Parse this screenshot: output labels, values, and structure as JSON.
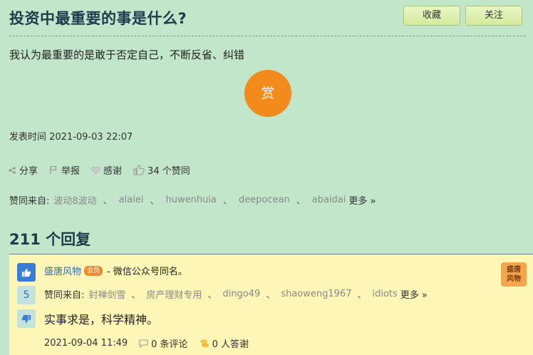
{
  "post": {
    "title": "投资中最重要的事是什么?",
    "body": "我认为最重要的是敢于否定自己，不断反省、纠错",
    "time_label": "发表时间 2021-09-03 22:07",
    "reward_label": "赏"
  },
  "buttons": {
    "favorite": "收藏",
    "follow": "关注"
  },
  "actions": {
    "share": "分享",
    "report": "举报",
    "thanks": "感谢",
    "likes": "34 个赞同"
  },
  "likers": {
    "label": "赞同来自:",
    "names": [
      "波动8波动",
      "alalei",
      "huwenhuia",
      "deepocean",
      "abaidai"
    ],
    "separator": "、",
    "more": "更多 »"
  },
  "replies_header": "211 个回复",
  "reply": {
    "author": "盛唐风物",
    "badge": "会员",
    "signature": "- 微信公众号同名。",
    "vote_count": "5",
    "likers_label": "赞同来自:",
    "likers": [
      "封禅剑雪",
      "房产理财专用",
      "dingo49",
      "shaoweng1967",
      "idiots"
    ],
    "separator": "、",
    "more": "更多 »",
    "text": "实事求是，科学精神。",
    "time": "2021-09-04 11:49",
    "comments": "0 条评论",
    "rewards": "0 人答谢",
    "avatar_text": "盛唐风物"
  },
  "colors": {
    "page_bg": "#c2e6c9",
    "reply_bg": "#fdf6b6",
    "reward": "#f28a1c",
    "link": "#2e6fb0"
  }
}
